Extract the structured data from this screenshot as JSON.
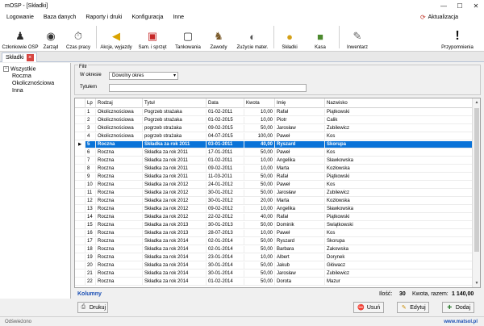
{
  "window": {
    "title": "mOSP - [Składki]",
    "controls": [
      "minimize-icon",
      "maximize-icon",
      "close-icon"
    ]
  },
  "menu": {
    "items": [
      "Logowanie",
      "Baza danych",
      "Raporty i druki",
      "Konfiguracja",
      "Inne"
    ],
    "update_label": "Aktualizacja"
  },
  "toolbar": {
    "buttons": [
      {
        "label": "Członkowie OSP",
        "icon": "firefighters-icon"
      },
      {
        "label": "Zarząd",
        "icon": "helmet-icon"
      },
      {
        "label": "Czas pracy",
        "icon": "stopwatch-icon"
      },
      {
        "label": "Akcje, wyjazdy",
        "icon": "horn-icon"
      },
      {
        "label": "Sam. i sprzęt",
        "icon": "fire-truck-icon"
      },
      {
        "label": "Tankowania",
        "icon": "fuel-can-icon"
      },
      {
        "label": "Zawody",
        "icon": "firefighter-icon"
      },
      {
        "label": "Zużycie mater.",
        "icon": "gauge-icon"
      },
      {
        "label": "Składki",
        "icon": "coins-icon"
      },
      {
        "label": "Kasa",
        "icon": "cash-icon"
      },
      {
        "label": "Inwentarz",
        "icon": "clipboard-icon"
      },
      {
        "label": "Przypomnienia",
        "icon": "exclamation-icon"
      }
    ]
  },
  "doc_tab": {
    "label": "Składki"
  },
  "tree": {
    "root": "Wszystkie",
    "children": [
      "Roczna",
      "Okolicznościowa",
      "Inna"
    ]
  },
  "filter": {
    "legend": "Filtr",
    "period_label": "W okresie",
    "period_value": "Dowolny okres",
    "title_label": "Tytułem",
    "title_value": ""
  },
  "table": {
    "columns": [
      "Lp",
      "Rodzaj",
      "Tytuł",
      "Data",
      "Kwota",
      "Imię",
      "Nazwisko"
    ],
    "selected_index": 4,
    "rows": [
      [
        "1",
        "Okolicznościowa",
        "Pogrzeb strażaka",
        "01-02-2011",
        "10,00",
        "Rafał",
        "Piątkowski"
      ],
      [
        "2",
        "Okolicznościowa",
        "Pogrzeb strażaka",
        "01-02-2015",
        "10,00",
        "Piotr",
        "Calik"
      ],
      [
        "3",
        "Okolicznościowa",
        "pogrzeb strażaka",
        "09-02-2015",
        "50,00",
        "Jarosław",
        "Zubilewicz"
      ],
      [
        "4",
        "Okolicznościowa",
        "pogrzeb strażaka",
        "04-07-2015",
        "100,00",
        "Paweł",
        "Kos"
      ],
      [
        "5",
        "Roczna",
        "Składka za rok 2011",
        "03-01-2011",
        "40,00",
        "Ryszard",
        "Skorupa"
      ],
      [
        "6",
        "Roczna",
        "Składka za rok 2011",
        "17-01-2011",
        "50,00",
        "Paweł",
        "Kos"
      ],
      [
        "7",
        "Roczna",
        "Składka za rok 2011",
        "01-02-2011",
        "10,00",
        "Angelika",
        "Sławkowska"
      ],
      [
        "8",
        "Roczna",
        "Składka za rok 2011",
        "09-02-2011",
        "10,00",
        "Marta",
        "Kozłowska"
      ],
      [
        "9",
        "Roczna",
        "Składka za rok 2011",
        "11-03-2011",
        "50,00",
        "Rafał",
        "Piątkowski"
      ],
      [
        "10",
        "Roczna",
        "Składka za rok 2012",
        "24-01-2012",
        "50,00",
        "Paweł",
        "Kos"
      ],
      [
        "11",
        "Roczna",
        "Składka za rok 2012",
        "30-01-2012",
        "50,00",
        "Jarosław",
        "Zubilewicz"
      ],
      [
        "12",
        "Roczna",
        "Składka za rok 2012",
        "30-01-2012",
        "20,00",
        "Marta",
        "Kozłowska"
      ],
      [
        "13",
        "Roczna",
        "Składka za rok 2012",
        "09-02-2012",
        "10,00",
        "Angelika",
        "Sławkowska"
      ],
      [
        "14",
        "Roczna",
        "Składka za rok 2012",
        "22-02-2012",
        "40,00",
        "Rafał",
        "Piątkowski"
      ],
      [
        "15",
        "Roczna",
        "Składka za rok 2013",
        "30-01-2013",
        "50,00",
        "Dominik",
        "Świątkowski"
      ],
      [
        "16",
        "Roczna",
        "Składka za rok 2013",
        "28-07-2013",
        "10,00",
        "Paweł",
        "Kos"
      ],
      [
        "17",
        "Roczna",
        "Składka za rok 2014",
        "02-01-2014",
        "50,00",
        "Ryszard",
        "Skorupa"
      ],
      [
        "18",
        "Roczna",
        "Składka za rok 2014",
        "02-01-2014",
        "50,00",
        "Barbara",
        "Zakowska"
      ],
      [
        "19",
        "Roczna",
        "Składka za rok 2014",
        "23-01-2014",
        "10,00",
        "Albert",
        "Dorynek"
      ],
      [
        "20",
        "Roczna",
        "Składka za rok 2014",
        "30-01-2014",
        "50,00",
        "Jakub",
        "Główacz"
      ],
      [
        "21",
        "Roczna",
        "Składka za rok 2014",
        "30-01-2014",
        "50,00",
        "Jarosław",
        "Zubilewicz"
      ],
      [
        "22",
        "Roczna",
        "Składka za rok 2014",
        "01-02-2014",
        "50,00",
        "Dorota",
        "Mazur"
      ]
    ]
  },
  "summary": {
    "columns_link": "Kolumny",
    "count_label": "Ilość:",
    "count_value": "30",
    "total_label": "Kwota, razem:",
    "total_value": "1 140,00"
  },
  "buttons": {
    "print": "Drukuj",
    "delete": "Usuń",
    "edit": "Edytuj",
    "add": "Dodaj"
  },
  "statusbar": {
    "status": "Odświeżono",
    "url": "www.matsol.pl"
  }
}
